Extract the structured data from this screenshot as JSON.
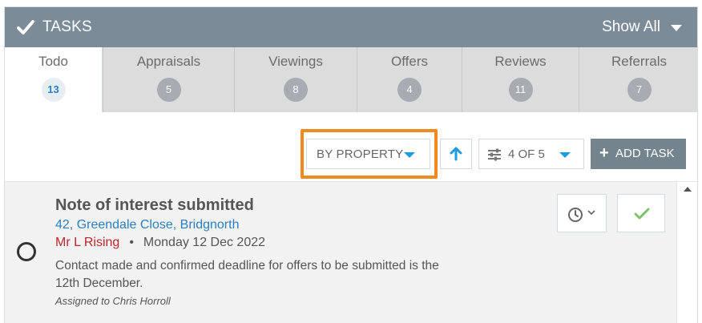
{
  "header": {
    "title": "TASKS",
    "show_all": "Show All"
  },
  "tabs": [
    {
      "label": "Todo",
      "count": "13",
      "active": true
    },
    {
      "label": "Appraisals",
      "count": "5"
    },
    {
      "label": "Viewings",
      "count": "8"
    },
    {
      "label": "Offers",
      "count": "4"
    },
    {
      "label": "Reviews",
      "count": "11"
    },
    {
      "label": "Referrals",
      "count": "7"
    }
  ],
  "toolbar": {
    "group_by": "BY PROPERTY",
    "filter": "4 OF 5",
    "add_task": "ADD TASK"
  },
  "task": {
    "title": "Note of interest submitted",
    "address": "42, Greendale Close, Bridgnorth",
    "contact": "Mr L Rising",
    "separator": "•",
    "date": "Monday 12 Dec 2022",
    "description": "Contact made and confirmed deadline for offers to be submitted is the 12th December.",
    "assigned": "Assigned to Chris Horroll"
  },
  "colors": {
    "header_bg": "#7b8b98",
    "highlight": "#f08a1e",
    "accent_blue": "#1f9be0",
    "contact_red": "#c0252b",
    "done_green": "#7cc36b"
  }
}
